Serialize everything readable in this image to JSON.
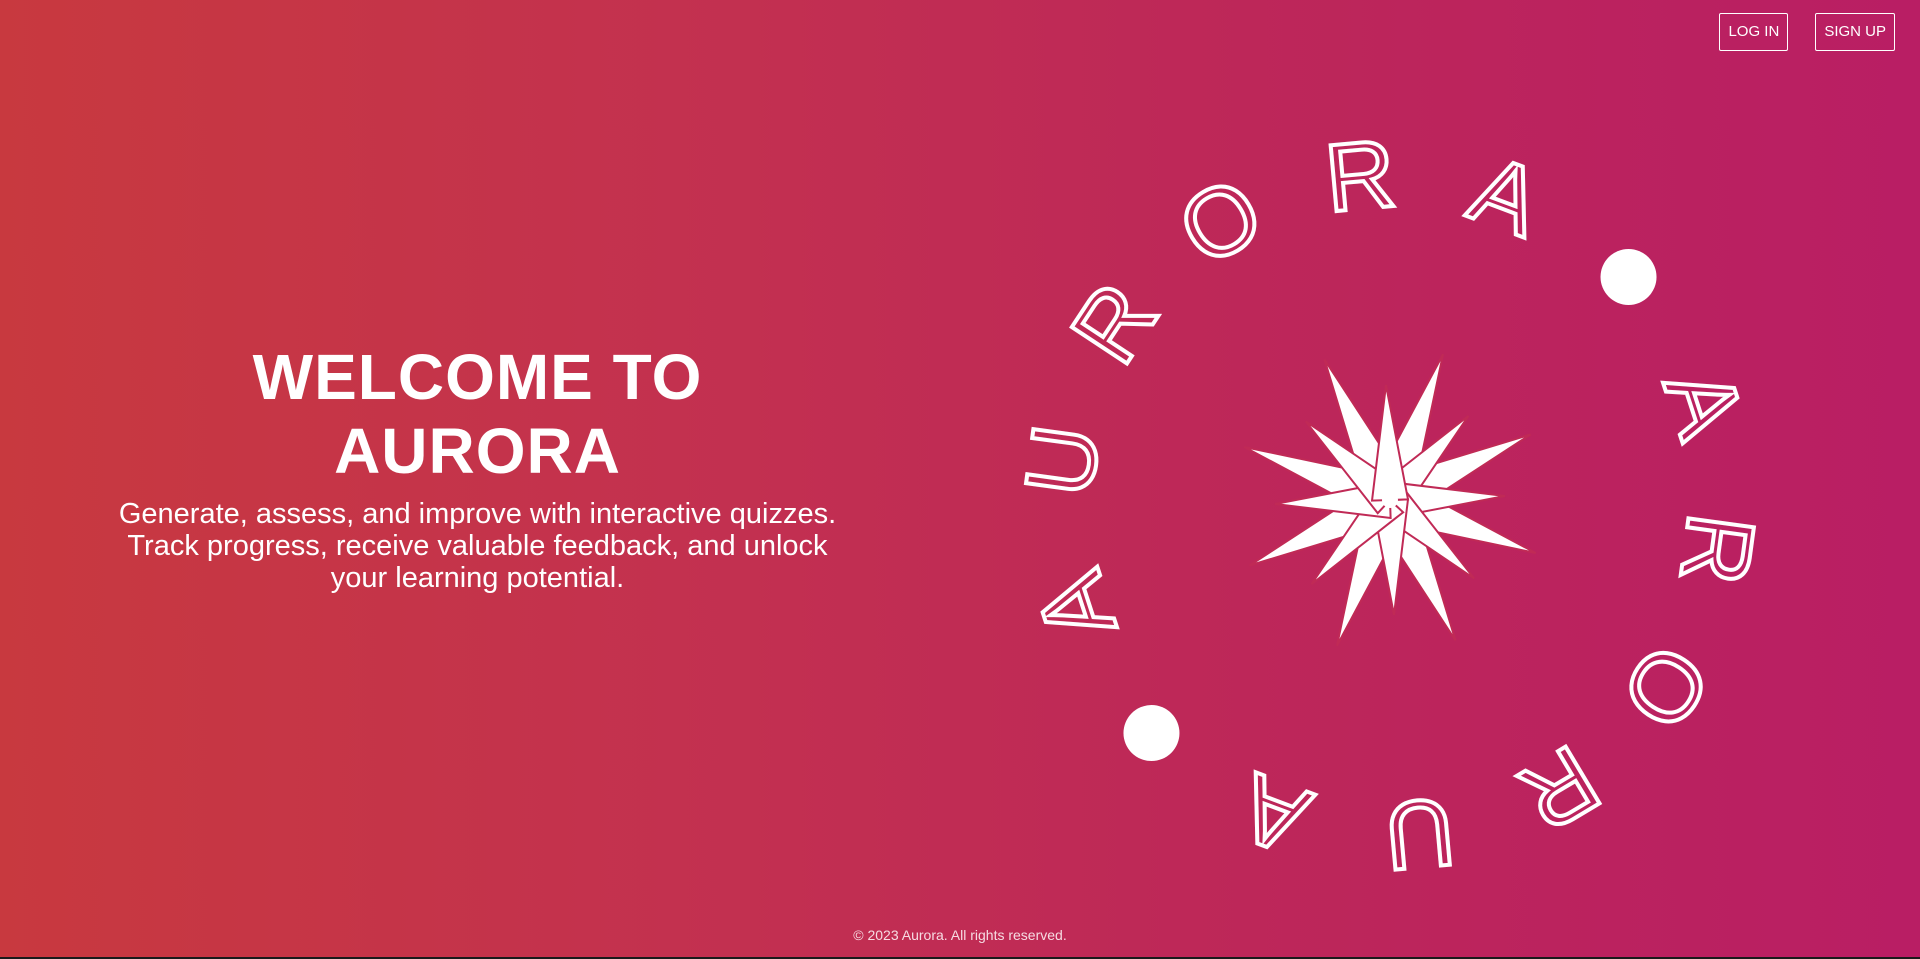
{
  "nav": {
    "login_label": "LOG IN",
    "signup_label": "SIGN UP"
  },
  "hero": {
    "title_line1": "WELCOME TO",
    "title_line2": "AURORA",
    "description": "Generate, assess, and improve with interactive quizzes. Track progress, receive valuable feedback, and unlock your learning potential."
  },
  "emblem": {
    "ring_letters": [
      "A",
      "U",
      "R",
      "O",
      "R",
      "A",
      "•",
      "A",
      "R",
      "O",
      "R",
      "U",
      "A",
      "•"
    ],
    "icon": "aurora-star-icon"
  },
  "footer": {
    "copyright": "© 2023 Aurora. All rights reserved."
  },
  "colors": {
    "gradient_start": "#c8393f",
    "gradient_end": "#b91e64",
    "text": "#ffffff"
  }
}
